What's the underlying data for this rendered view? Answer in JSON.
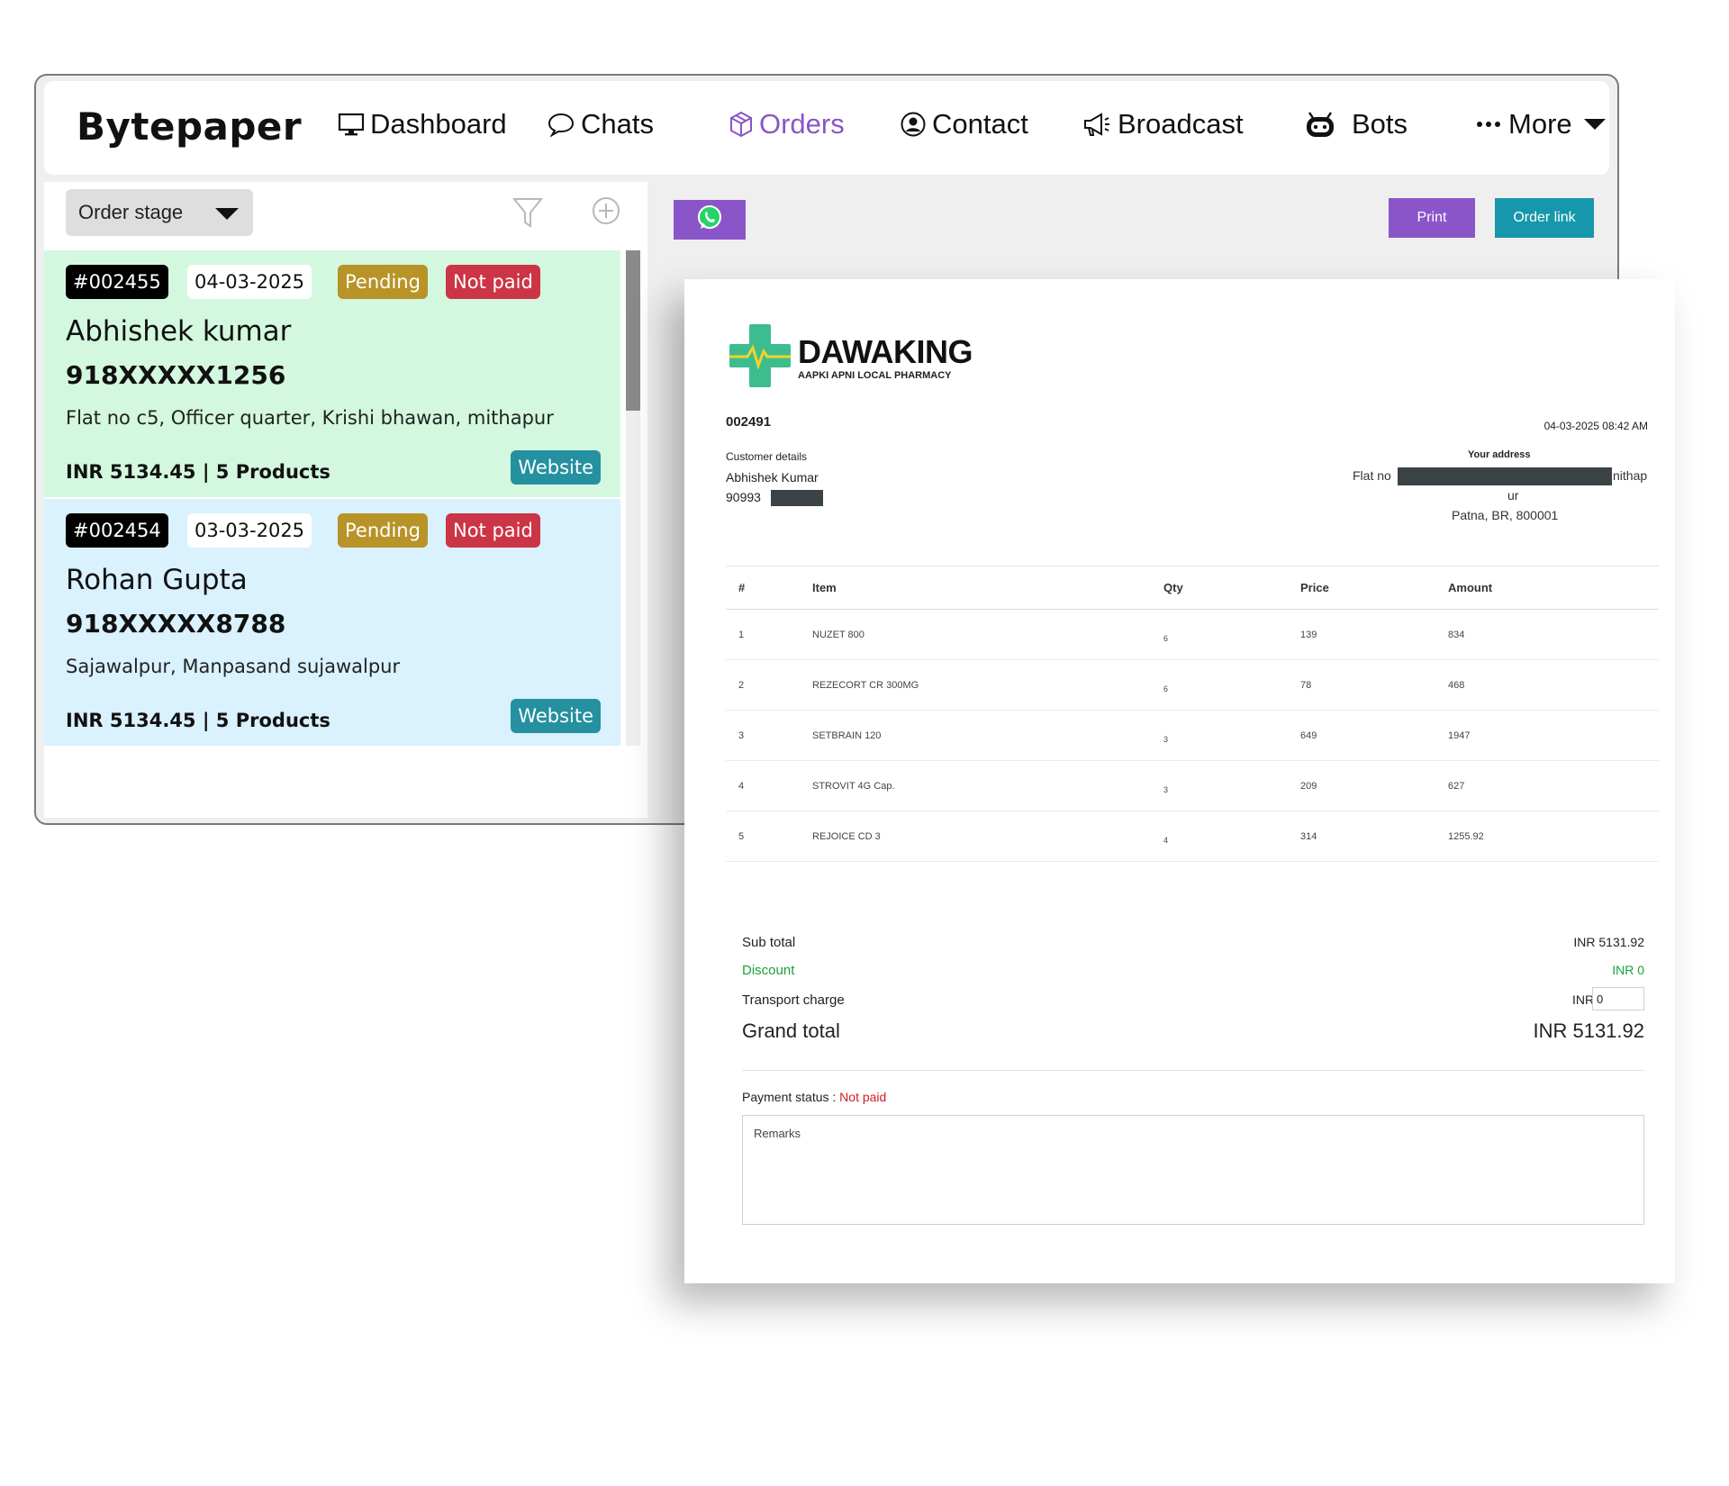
{
  "app": {
    "brand": "Bytepaper"
  },
  "nav": [
    {
      "label": "Dashboard",
      "icon": "monitor-icon"
    },
    {
      "label": "Chats",
      "icon": "chat-bubble-icon"
    },
    {
      "label": "Orders",
      "icon": "box-icon",
      "active": true
    },
    {
      "label": "Contact",
      "icon": "user-circle-icon"
    },
    {
      "label": "Broadcast",
      "icon": "megaphone-icon"
    },
    {
      "label": "Bots",
      "icon": "robot-icon"
    },
    {
      "label": "More",
      "icon": "dots-icon"
    }
  ],
  "filters": {
    "stage_label": "Order stage"
  },
  "orders": [
    {
      "id": "#002455",
      "date": "04-03-2025",
      "status": "Pending",
      "payment": "Not paid",
      "name": "Abhishek kumar",
      "phone": "918XXXXX1256",
      "address": "Flat no c5, Officer quarter, Krishi bhawan, mithapur",
      "total": "INR 5134.45 | 5 Products",
      "source": "Website"
    },
    {
      "id": "#002454",
      "date": "03-03-2025",
      "status": "Pending",
      "payment": "Not paid",
      "name": "Rohan Gupta",
      "phone": "918XXXXX8788",
      "address": "Sajawalpur, Manpasand sujawalpur",
      "total": "INR 5134.45 | 5 Products",
      "source": "Website"
    }
  ],
  "actions": {
    "print": "Print",
    "order_link": "Order link",
    "whatsapp_icon": "whatsapp-icon"
  },
  "invoice": {
    "brand_name": "DAWAKING",
    "brand_tagline": "AAPKI APNI LOCAL PHARMACY",
    "number": "002491",
    "datetime": "04-03-2025 08:42 AM",
    "customer_label": "Customer details",
    "customer_name": "Abhishek Kumar",
    "customer_phone_visible": "90993",
    "address_label": "Your address",
    "address_prefix": "Flat no",
    "address_tail": "nithap",
    "address_line2": "ur",
    "address_line3": "Patna, BR, 800001",
    "columns": [
      "#",
      "Item",
      "Qty",
      "Price",
      "Amount"
    ],
    "items": [
      {
        "n": "1",
        "item": "NUZET 800",
        "qty": "6",
        "price": "139",
        "amount": "834"
      },
      {
        "n": "2",
        "item": "REZECORT CR 300MG",
        "qty": "6",
        "price": "78",
        "amount": "468"
      },
      {
        "n": "3",
        "item": "SETBRAIN 120",
        "qty": "3",
        "price": "649",
        "amount": "1947"
      },
      {
        "n": "4",
        "item": "STROVIT 4G Cap.",
        "qty": "3",
        "price": "209",
        "amount": "627"
      },
      {
        "n": "5",
        "item": "REJOICE CD 3",
        "qty": "4",
        "price": "314",
        "amount": "1255.92"
      }
    ],
    "subtotal_label": "Sub total",
    "subtotal_value": "INR 5131.92",
    "discount_label": "Discount",
    "discount_value": "INR 0",
    "transport_label": "Transport charge",
    "transport_currency": "INR",
    "transport_value": "0",
    "grand_label": "Grand total",
    "grand_value": "INR 5131.92",
    "payment_label": "Payment status : ",
    "payment_value": "Not paid",
    "remarks_placeholder": "Remarks"
  },
  "colors": {
    "accent_purple": "#8a55c9",
    "teal": "#1697ab",
    "card_green": "#d3f8df",
    "card_blue": "#daf1fe",
    "pending": "#b89327",
    "not_paid": "#cc3545"
  }
}
